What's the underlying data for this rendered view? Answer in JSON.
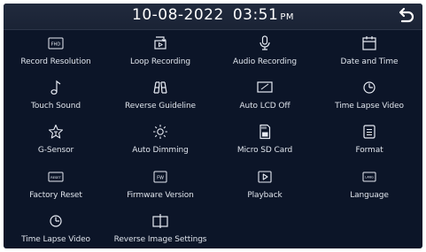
{
  "header": {
    "date": "10-08-2022",
    "time": "03:51",
    "ampm": "PM",
    "back_icon": "back-arrow-icon"
  },
  "menu": [
    {
      "label": "Record Resolution",
      "icon": "fhd-icon",
      "icon_text": "FHD"
    },
    {
      "label": "Loop Recording",
      "icon": "loop-recording-icon"
    },
    {
      "label": "Audio Recording",
      "icon": "microphone-icon"
    },
    {
      "label": "Date and Time",
      "icon": "calendar-icon"
    },
    {
      "label": "Touch Sound",
      "icon": "music-note-icon"
    },
    {
      "label": "Reverse Guideline",
      "icon": "reverse-guideline-icon"
    },
    {
      "label": "Auto LCD Off",
      "icon": "lcd-off-icon"
    },
    {
      "label": "Time Lapse Video",
      "icon": "clock-icon"
    },
    {
      "label": "G-Sensor",
      "icon": "g-sensor-icon"
    },
    {
      "label": "Auto Dimming",
      "icon": "sun-icon"
    },
    {
      "label": "Micro SD Card",
      "icon": "sd-card-icon"
    },
    {
      "label": "Format",
      "icon": "format-icon"
    },
    {
      "label": "Factory Reset",
      "icon": "reset-icon",
      "icon_text": "RESET"
    },
    {
      "label": "Firmware Version",
      "icon": "firmware-icon",
      "icon_text": "FW"
    },
    {
      "label": "Playback",
      "icon": "play-icon"
    },
    {
      "label": "Language",
      "icon": "language-icon",
      "icon_text": "LANG"
    },
    {
      "label": "Time Lapse Video",
      "icon": "clock-icon"
    },
    {
      "label": "Reverse Image Settings",
      "icon": "reverse-image-icon"
    }
  ]
}
